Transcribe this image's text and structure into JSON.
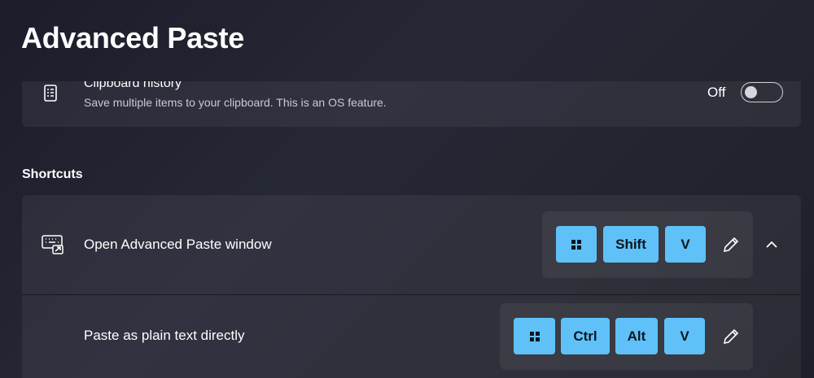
{
  "page": {
    "title": "Advanced Paste"
  },
  "clipboard_history": {
    "title": "Clipboard history",
    "description": "Save multiple items to your clipboard. This is an OS feature.",
    "toggle_label": "Off",
    "toggle_on": false
  },
  "shortcuts": {
    "section_title": "Shortcuts",
    "rows": [
      {
        "label": "Open Advanced Paste window",
        "keys": [
          "win",
          "Shift",
          "V"
        ]
      },
      {
        "label": "Paste as plain text directly",
        "keys": [
          "win",
          "Ctrl",
          "Alt",
          "V"
        ]
      }
    ]
  },
  "colors": {
    "key_accent": "#5fc1f7",
    "key_text": "#0b1620"
  },
  "icons": [
    "clipboard-list-icon",
    "keyboard-shortcut-icon",
    "windows-logo-icon",
    "pencil-edit-icon",
    "chevron-up-icon"
  ]
}
